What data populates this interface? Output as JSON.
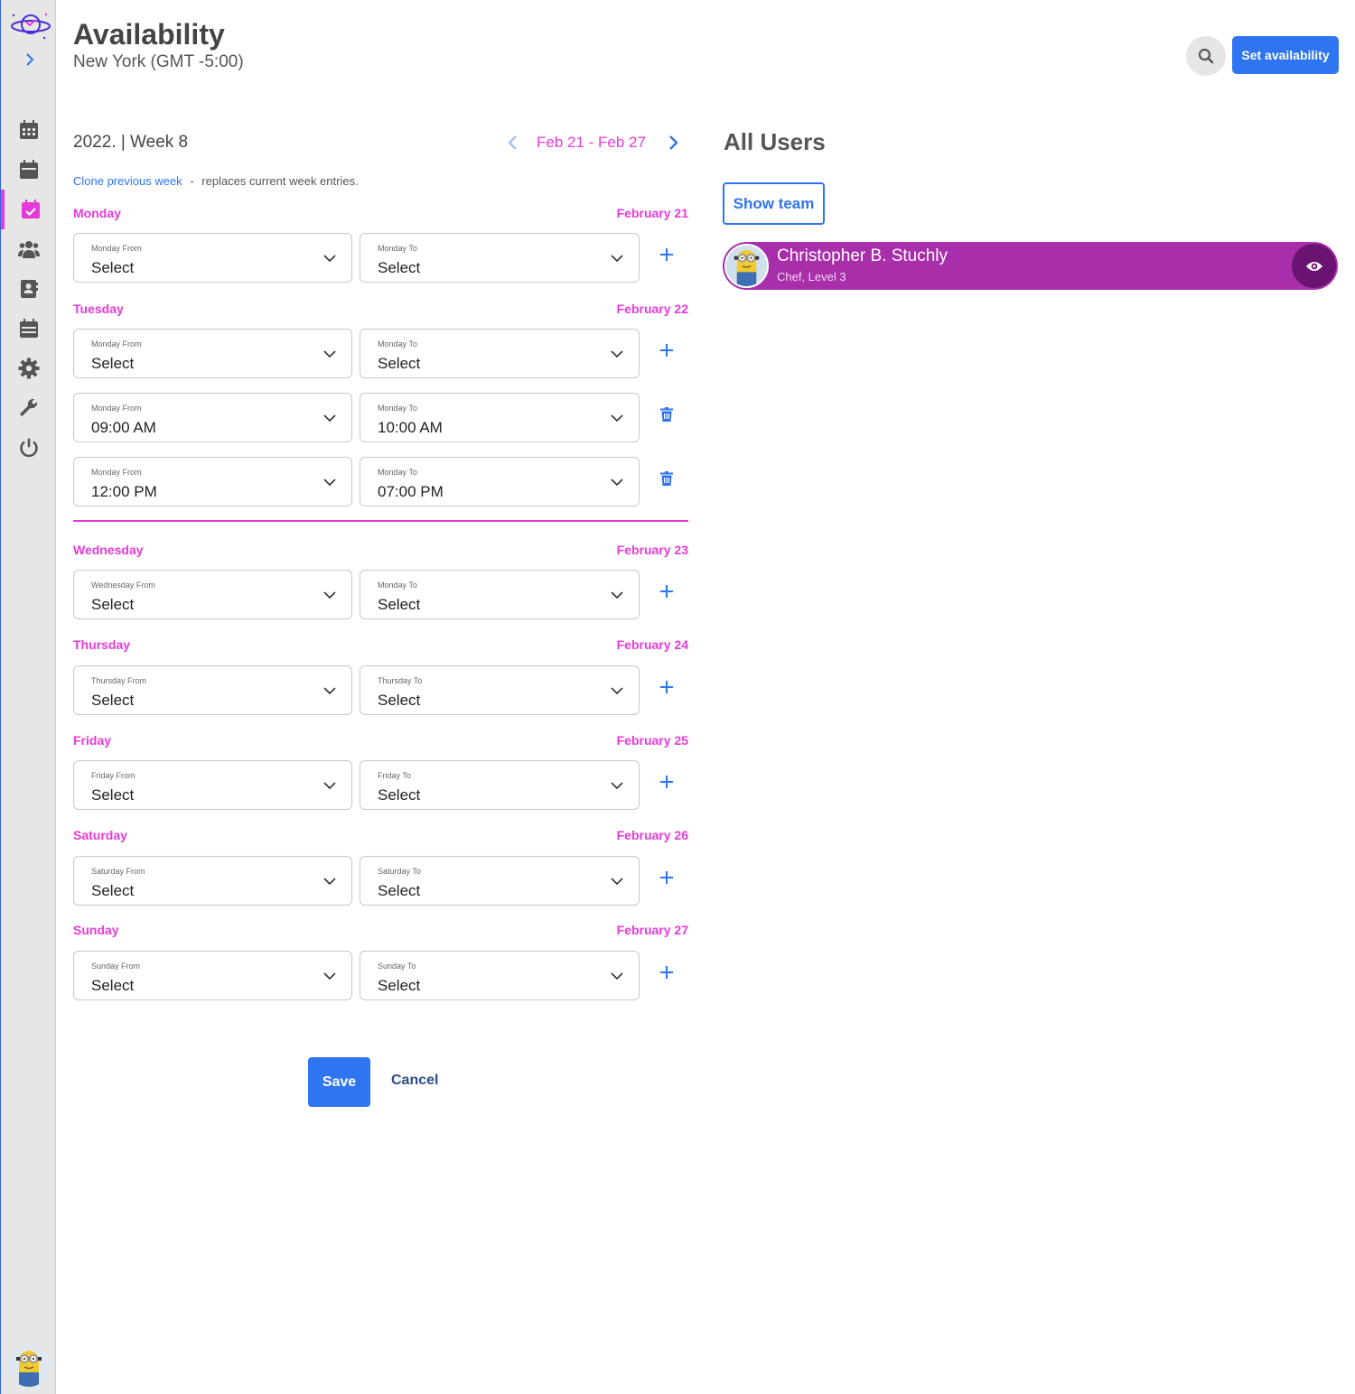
{
  "header": {
    "title": "Availability",
    "timezone": "New York (GMT -5:00)",
    "set_availability_label": "Set availability"
  },
  "sidebar": {
    "items": [
      {
        "icon": "calendar-grid-icon",
        "active": false
      },
      {
        "icon": "calendar-icon",
        "active": false
      },
      {
        "icon": "calendar-check-icon",
        "active": true
      },
      {
        "icon": "users-icon",
        "active": false
      },
      {
        "icon": "contact-book-icon",
        "active": false
      },
      {
        "icon": "calendar-alt-icon",
        "active": false
      },
      {
        "icon": "gear-icon",
        "active": false
      },
      {
        "icon": "wrench-icon",
        "active": false
      },
      {
        "icon": "power-icon",
        "active": false
      }
    ]
  },
  "week": {
    "label": "2022. | Week 8",
    "range": "Feb 21 - Feb 27",
    "clone_link": "Clone previous week",
    "clone_note": "replaces current week entries.",
    "separator": "-"
  },
  "days": {
    "monday": {
      "name": "Monday",
      "date": "February 21"
    },
    "tuesday": {
      "name": "Tuesday",
      "date": "February 22"
    },
    "wednesday": {
      "name": "Wednesday",
      "date": "February 23"
    },
    "thursday": {
      "name": "Thursday",
      "date": "February 24"
    },
    "friday": {
      "name": "Friday",
      "date": "February 25"
    },
    "saturday": {
      "name": "Saturday",
      "date": "February 26"
    },
    "sunday": {
      "name": "Sunday",
      "date": "February 27"
    }
  },
  "rows": {
    "mon1": {
      "from_label": "Monday From",
      "from_value": "Select",
      "to_label": "Monday To",
      "to_value": "Select"
    },
    "tue1": {
      "from_label": "Monday From",
      "from_value": "Select",
      "to_label": "Monday To",
      "to_value": "Select"
    },
    "tue2": {
      "from_label": "Monday From",
      "from_value": "09:00 AM",
      "to_label": "Monday To",
      "to_value": "10:00 AM"
    },
    "tue3": {
      "from_label": "Monday From",
      "from_value": "12:00 PM",
      "to_label": "Monday To",
      "to_value": "07:00 PM"
    },
    "wed1": {
      "from_label": "Wednesday From",
      "from_value": "Select",
      "to_label": "Monday To",
      "to_value": "Select"
    },
    "thu1": {
      "from_label": "Thursday From",
      "from_value": "Select",
      "to_label": "Thursday To",
      "to_value": "Select"
    },
    "fri1": {
      "from_label": "Friday From",
      "from_value": "Select",
      "to_label": "Friday To",
      "to_value": "Select"
    },
    "sat1": {
      "from_label": "Saturday From",
      "from_value": "Select",
      "to_label": "Saturday To",
      "to_value": "Select"
    },
    "sun1": {
      "from_label": "Sunday From",
      "from_value": "Select",
      "to_label": "Sunday To",
      "to_value": "Select"
    }
  },
  "actions": {
    "save": "Save",
    "cancel": "Cancel"
  },
  "users": {
    "title": "All Users",
    "show_team": "Show team",
    "list": [
      {
        "name": "Christopher B. Stuchly",
        "role": "Chef, Level 3"
      }
    ]
  },
  "colors": {
    "accent_blue": "#2f74f0",
    "accent_pink": "#e63ad8",
    "user_card": "#a82eaa"
  }
}
